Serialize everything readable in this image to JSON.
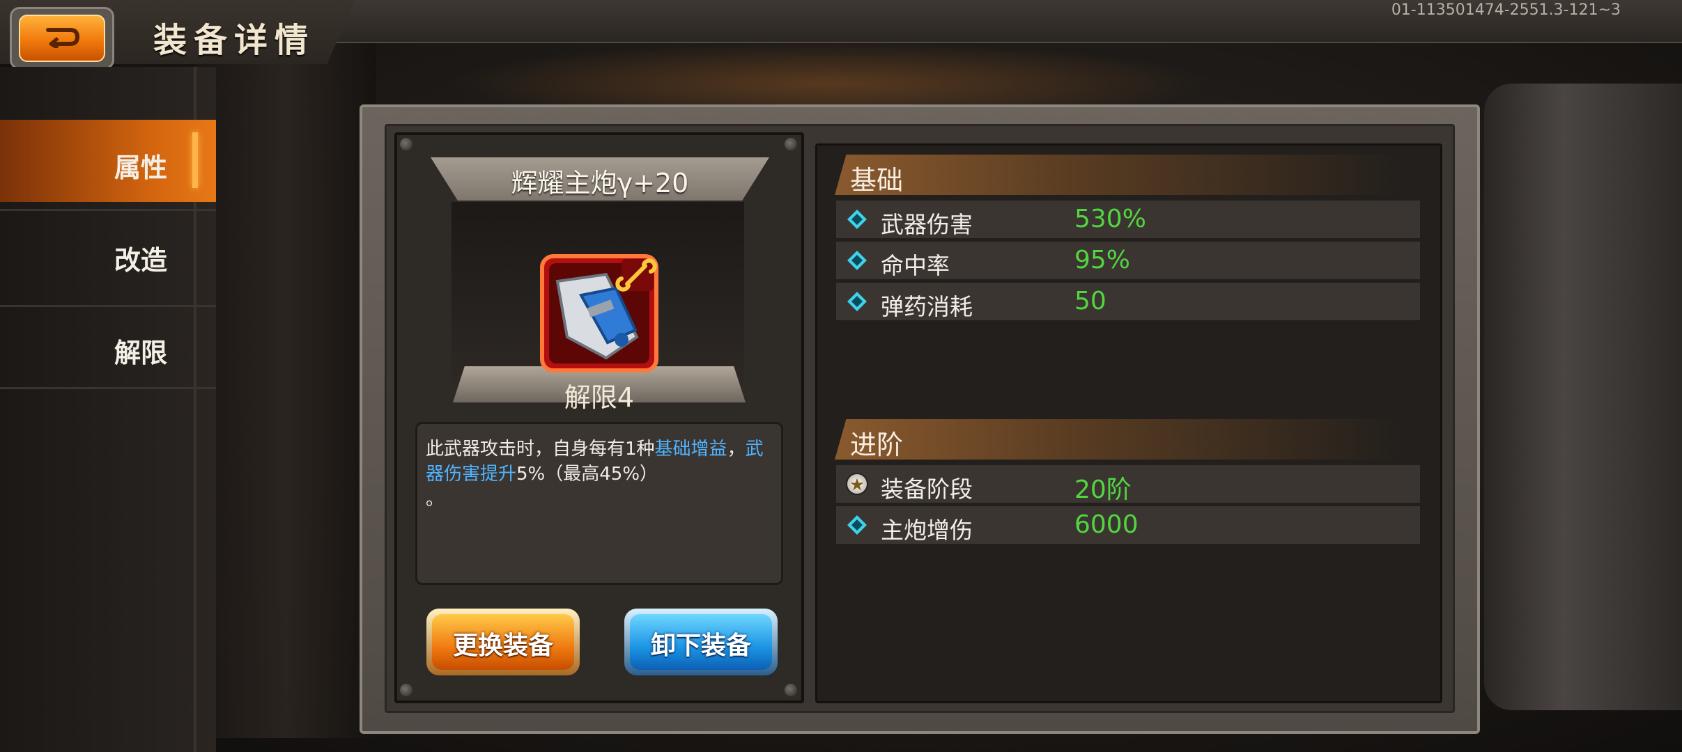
{
  "header": {
    "title": "装备详情",
    "build_id": "01-113501474-2551.3-121~3"
  },
  "sidebar": {
    "items": [
      {
        "label": "属性",
        "active": true
      },
      {
        "label": "改造",
        "active": false
      },
      {
        "label": "解限",
        "active": false
      }
    ]
  },
  "equipment": {
    "name": "辉耀主炮γ+20",
    "tier_label": "解限4",
    "icon": "main-cannon-icon",
    "description": {
      "part1": "此武器攻击时，自身每有1种",
      "link1": "基础增益",
      "part2": "，",
      "link2": "武器伤害提升",
      "part3": "5%（最高45%）",
      "part4": "。"
    },
    "buttons": {
      "replace": "更换装备",
      "unequip": "卸下装备"
    }
  },
  "stats": {
    "basic": {
      "title": "基础",
      "rows": [
        {
          "name": "武器伤害",
          "value": "530%",
          "icon": "diamond-icon"
        },
        {
          "name": "命中率",
          "value": "95%",
          "icon": "diamond-icon"
        },
        {
          "name": "弹药消耗",
          "value": "50",
          "icon": "diamond-icon"
        }
      ]
    },
    "advanced": {
      "title": "进阶",
      "rows": [
        {
          "name": "装备阶段",
          "value": "20阶",
          "icon": "star-icon"
        },
        {
          "name": "主炮增伤",
          "value": "6000",
          "icon": "diamond-icon"
        }
      ]
    }
  },
  "colors": {
    "accent_orange": "#f07a11",
    "stat_value_green": "#52d640",
    "highlight_blue": "#4fb4ff",
    "button_blue": "#1b94e4"
  }
}
